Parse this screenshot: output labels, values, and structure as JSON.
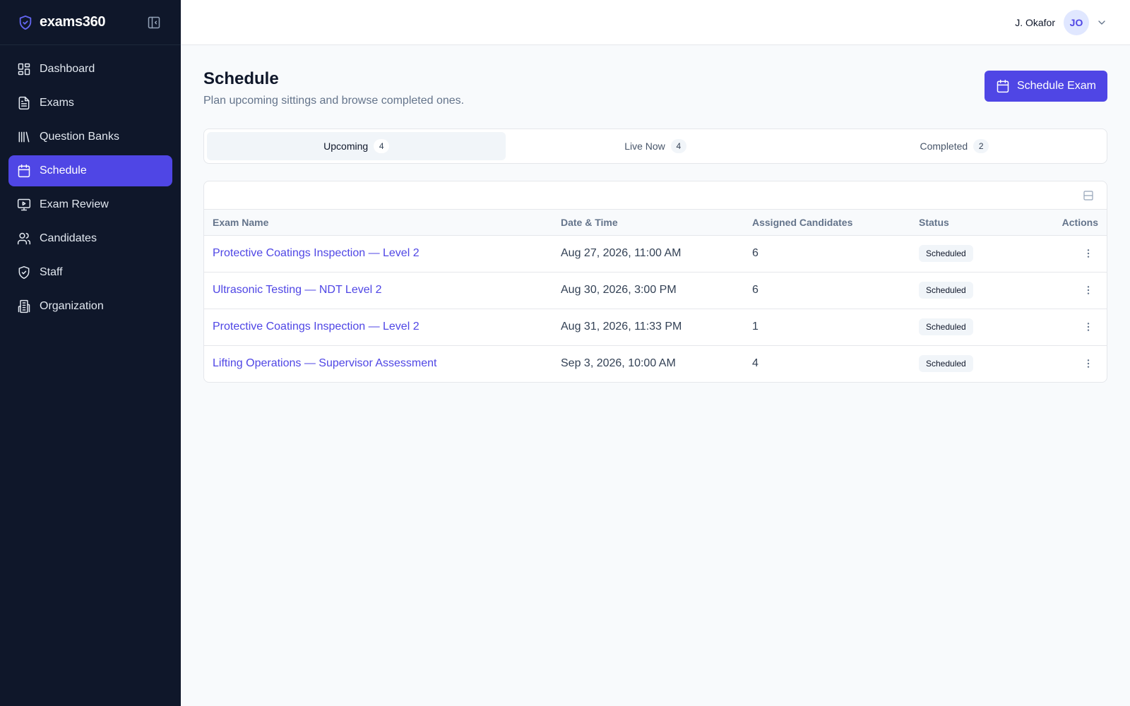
{
  "brand": {
    "name": "exams360",
    "logo_icon": "shield-check-icon",
    "accent": "#4f46e5"
  },
  "sidebar": {
    "collapse_icon": "sidebar-collapse-icon",
    "items": [
      {
        "label": "Dashboard",
        "icon": "dashboard-icon",
        "active": false
      },
      {
        "label": "Exams",
        "icon": "document-icon",
        "active": false
      },
      {
        "label": "Question Banks",
        "icon": "library-icon",
        "active": false
      },
      {
        "label": "Schedule",
        "icon": "calendar-icon",
        "active": true
      },
      {
        "label": "Exam Review",
        "icon": "monitor-play-icon",
        "active": false
      },
      {
        "label": "Candidates",
        "icon": "users-icon",
        "active": false
      },
      {
        "label": "Staff",
        "icon": "shield-check-icon",
        "active": false
      },
      {
        "label": "Organization",
        "icon": "building-icon",
        "active": false
      }
    ]
  },
  "topbar": {
    "user_name": "J. Okafor",
    "avatar_initials": "JO"
  },
  "page": {
    "title": "Schedule",
    "subtitle": "Plan upcoming sittings and browse completed ones.",
    "primary_button": "Schedule Exam"
  },
  "tabs": [
    {
      "label": "Upcoming",
      "count": "4",
      "active": true
    },
    {
      "label": "Live Now",
      "count": "4",
      "active": false
    },
    {
      "label": "Completed",
      "count": "2",
      "active": false
    }
  ],
  "table": {
    "columns": [
      "Exam Name",
      "Date & Time",
      "Assigned Candidates",
      "Status",
      "Actions"
    ],
    "rows": [
      {
        "exam_name": "Protective Coatings Inspection — Level 2",
        "date_time": "Aug 27, 2026, 11:00 AM",
        "candidates": "6",
        "status": "Scheduled"
      },
      {
        "exam_name": "Ultrasonic Testing — NDT Level 2",
        "date_time": "Aug 30, 2026, 3:00 PM",
        "candidates": "6",
        "status": "Scheduled"
      },
      {
        "exam_name": "Protective Coatings Inspection — Level 2",
        "date_time": "Aug 31, 2026, 11:33 PM",
        "candidates": "1",
        "status": "Scheduled"
      },
      {
        "exam_name": "Lifting Operations — Supervisor Assessment",
        "date_time": "Sep 3, 2026, 10:00 AM",
        "candidates": "4",
        "status": "Scheduled"
      }
    ]
  }
}
